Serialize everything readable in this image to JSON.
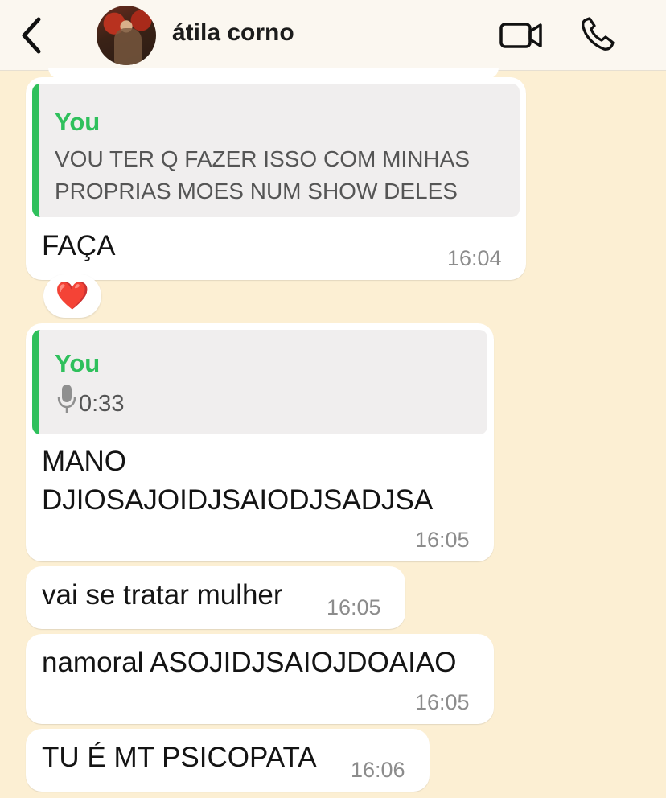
{
  "header": {
    "contact_name": "átila corno",
    "icons": {
      "back": "chevron-left-icon",
      "video": "video-camera-icon",
      "call": "phone-icon"
    }
  },
  "messages": [
    {
      "quote_author": "You",
      "quote_lines": [
        "VOU TER Q FAZER ISSO COM MINHAS",
        "PROPRIAS MOES NUM SHOW DELES"
      ],
      "text": "FAÇA",
      "time": "16:04",
      "reaction": "❤️"
    },
    {
      "quote_author": "You",
      "quote_audio_duration": "0:33",
      "lines": [
        "MANO",
        "DJIOSAJOIDJSAIODJSADJSA"
      ],
      "time": "16:05"
    },
    {
      "text": "vai se tratar mulher",
      "time": "16:05"
    },
    {
      "text": "namoral ASOJIDJSAIOJDOAIAO",
      "time": "16:05"
    },
    {
      "text": "TU É MT PSICOPATA",
      "time": "16:06"
    }
  ],
  "colors": {
    "background": "#fcefd3",
    "quote_accent": "#2fc05c",
    "bubble": "#ffffff"
  }
}
